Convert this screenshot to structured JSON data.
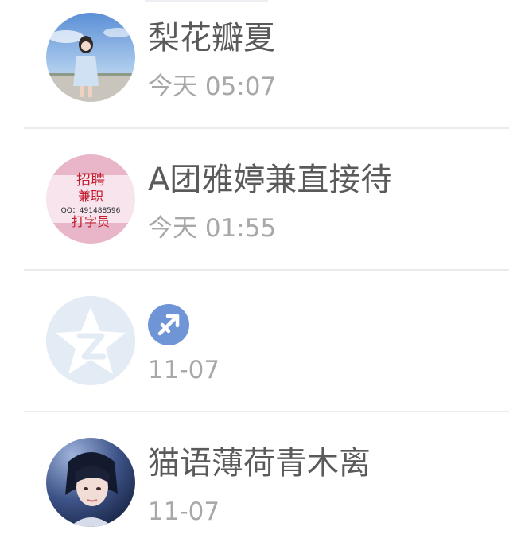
{
  "contacts": [
    {
      "name": "梨花瓣夏",
      "time": "今天 05:07"
    },
    {
      "name": "A团雅婷兼直接待",
      "time": "今天 01:55",
      "avatar_text": [
        "招聘",
        "兼职",
        "QQ：491488596",
        "打字员"
      ]
    },
    {
      "name": "",
      "time": "11-07",
      "badge": "sagittarius-icon"
    },
    {
      "name": "猫语薄荷青木离",
      "time": "11-07"
    }
  ],
  "colors": {
    "name_text": "#5a5a5a",
    "time_text": "#a8a8a8",
    "divider": "#e9ebee",
    "zodiac_badge": "#6f95d6",
    "default_avatar_bg": "#e3ebf5"
  }
}
